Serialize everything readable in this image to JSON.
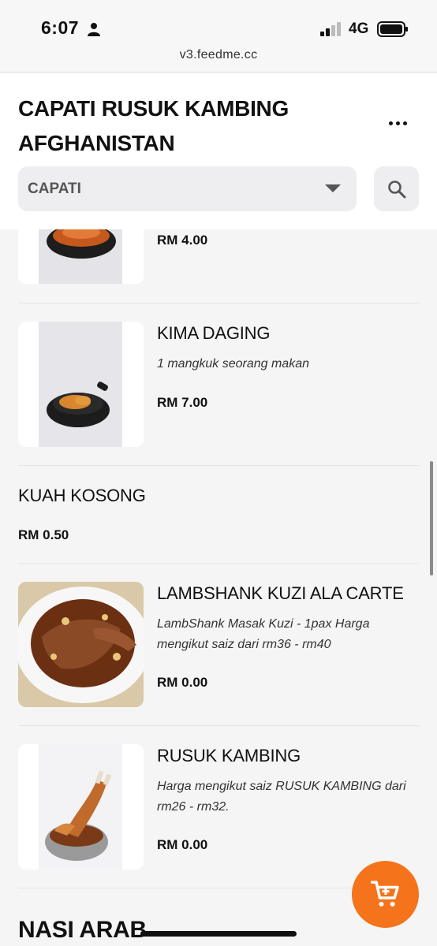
{
  "status_bar": {
    "time": "6:07",
    "network": "4G",
    "url": "v3.feedme.cc"
  },
  "header": {
    "store_title": "CAPATI RUSUK KAMBING AFGHANISTAN",
    "category_selected": "CAPATI"
  },
  "menu": {
    "items": [
      {
        "name": "",
        "description": "",
        "price": "RM 4.00",
        "icon": "food-bowl-image"
      },
      {
        "name": "KIMA DAGING",
        "description": "1 mangkuk seorang makan",
        "price": "RM 7.00",
        "icon": "food-bowl-image"
      },
      {
        "name": "KUAH KOSONG",
        "description": "",
        "price": "RM 0.50",
        "icon": ""
      },
      {
        "name": "LAMBSHANK KUZI ALA CARTE",
        "description": "LambShank Masak Kuzi - 1pax Harga mengikut saiz dari rm36 - rm40",
        "price": "RM 0.00",
        "icon": "lamb-plate-image"
      },
      {
        "name": "RUSUK KAMBING",
        "description": "Harga mengikut saiz RUSUK KAMBING dari rm26 - rm32.",
        "price": "RM 0.00",
        "icon": "ribs-bowl-image"
      }
    ],
    "next_section": "NASI ARAB"
  },
  "colors": {
    "accent": "#f5731b",
    "background": "#f5f5f5",
    "select_bg": "#eeeef1"
  }
}
